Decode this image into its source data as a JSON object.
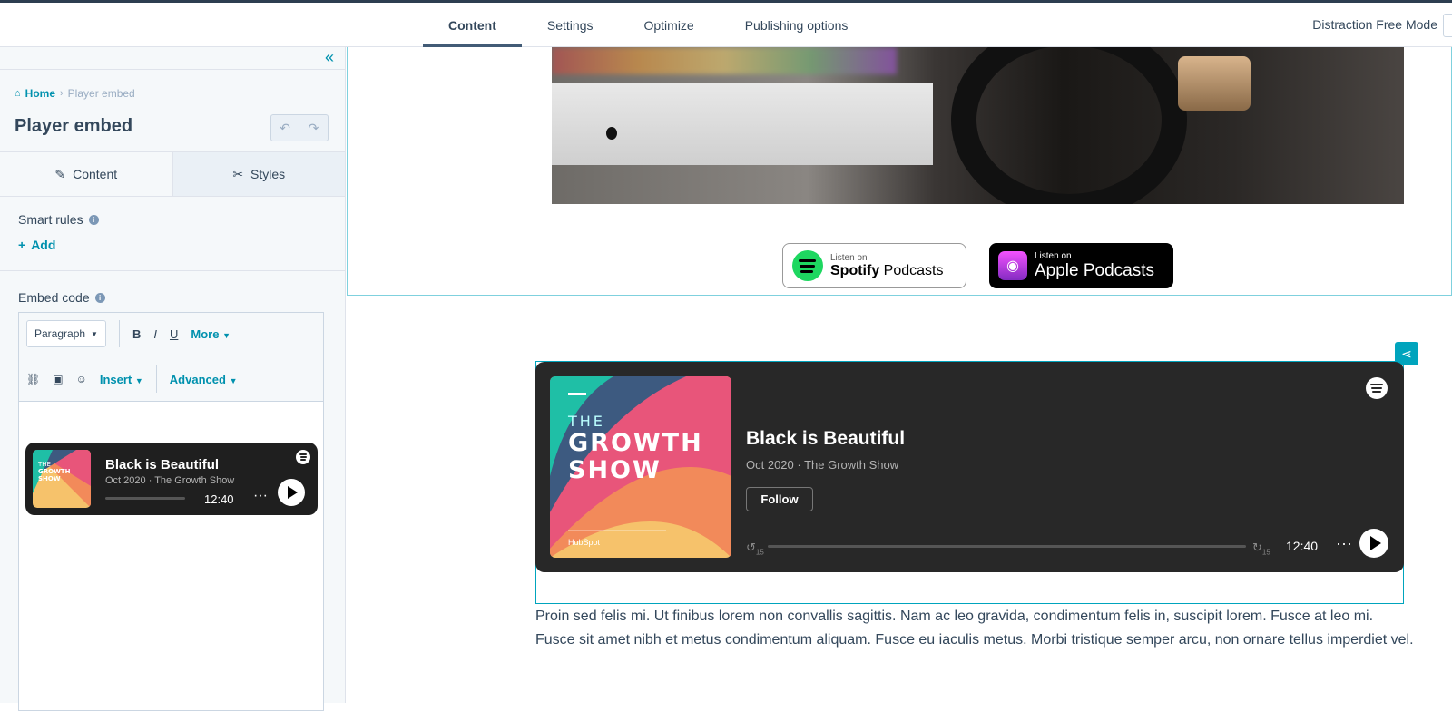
{
  "top_tabs": [
    {
      "label": "Content",
      "active": true
    },
    {
      "label": "Settings"
    },
    {
      "label": "Optimize"
    },
    {
      "label": "Publishing options"
    }
  ],
  "distraction_free": "Distraction Free Mode",
  "sidebar": {
    "breadcrumb": {
      "home": "Home",
      "current": "Player embed"
    },
    "title": "Player embed",
    "panel_tabs": {
      "content": "Content",
      "styles": "Styles"
    },
    "smart_rules": "Smart rules",
    "add": "Add",
    "embed_code": "Embed code",
    "editor": {
      "paragraph": "Paragraph",
      "bold": "B",
      "italic": "I",
      "underline": "U",
      "more": "More",
      "insert": "Insert",
      "advanced": "Advanced"
    },
    "mini_player": {
      "title": "Black is Beautiful",
      "subtitle": "Oct 2020 · The Growth Show",
      "time": "12:40",
      "cover_the": "THE",
      "cover_line1": "GROWTH",
      "cover_line2": "SHOW"
    }
  },
  "badges": {
    "spotify_small": "Listen on",
    "spotify_brand": "Spotify",
    "spotify_rest": "Podcasts",
    "apple_small": "Listen on",
    "apple_big": "Apple Podcasts"
  },
  "player": {
    "cover_the": "THE",
    "cover_line1": "GROWTH",
    "cover_line2": "SHOW",
    "cover_brand": "HubSpot",
    "title": "Black is Beautiful",
    "subtitle": "Oct 2020 · The Growth Show",
    "follow": "Follow",
    "skip_back": "15",
    "skip_fwd": "15",
    "time": "12:40",
    "more": "···"
  },
  "body_text": "Proin sed felis mi. Ut finibus lorem non convallis sagittis. Nam ac leo gravida, condimentum felis in, suscipit lorem. Fusce at leo mi. Fusce sit amet nibh et metus condimentum aliquam. Fusce eu iaculis metus. Morbi tristique semper arcu, non ornare tellus imperdiet vel."
}
